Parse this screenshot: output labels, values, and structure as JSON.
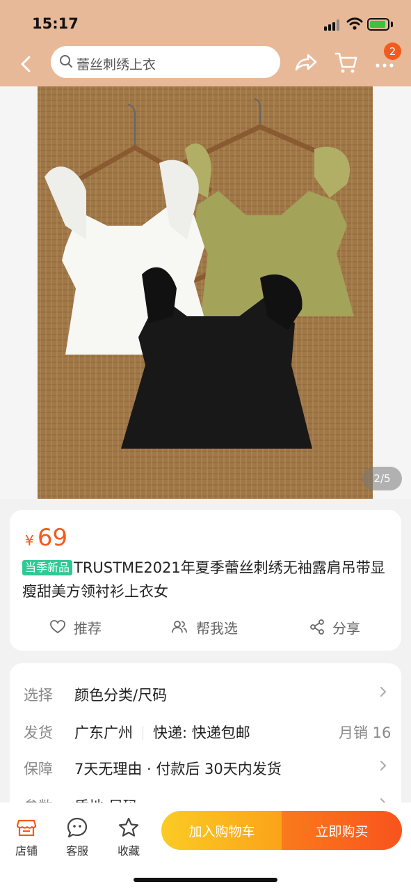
{
  "status": {
    "time": "15:17"
  },
  "search": {
    "query": "蕾丝刺绣上衣"
  },
  "header": {
    "cart_badge": "2"
  },
  "gallery": {
    "counter": "2/5"
  },
  "product": {
    "price_symbol": "¥",
    "price": "69",
    "tag": "当季新品",
    "title": "TRUSTME2021年夏季蕾丝刺绣无袖露肩吊带显瘦甜美方领衬衫上衣女"
  },
  "actions": {
    "recommend": "推荐",
    "help_choose": "帮我选",
    "share": "分享"
  },
  "specs": {
    "select_key": "选择",
    "select_val": "颜色分类/尺码",
    "ship_key": "发货",
    "ship_from": "广东广州",
    "ship_method": "快递: 快递包邮",
    "monthly_sales": "月销 16",
    "guarantee_key": "保障",
    "guarantee_val": "7天无理由 · 付款后 30天内发货",
    "params_key": "参数",
    "params_val": "质地 尺码"
  },
  "bottom": {
    "store": "店铺",
    "service": "客服",
    "favorite": "收藏",
    "add_cart": "加入购物车",
    "buy_now": "立即购买"
  },
  "colors": {
    "accent": "#f55a1a",
    "header_bg": "#e8b998",
    "tag_green": "#2fc995",
    "cart_btn": "#fbb820",
    "buy_btn": "#f9531d"
  }
}
